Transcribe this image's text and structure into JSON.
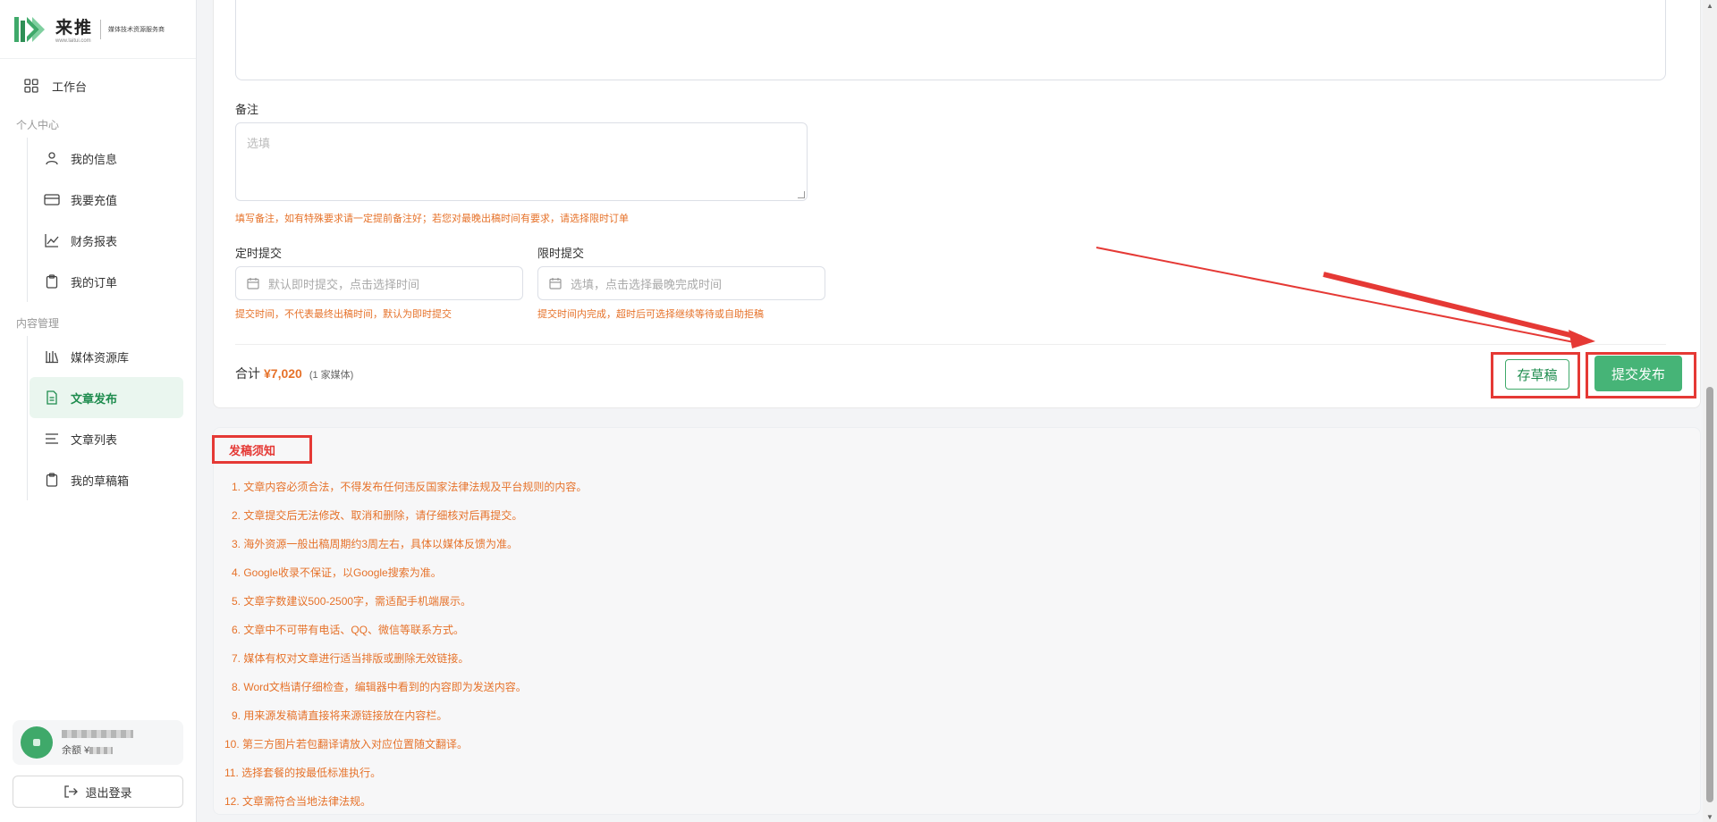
{
  "brand": {
    "title": "来推",
    "url": "www.laitui.com",
    "slogan": "媒体技术资源服务商",
    "green": "#3fa96a"
  },
  "sidebar": {
    "workbench": "工作台",
    "groups": [
      {
        "title": "个人中心",
        "items": [
          {
            "label": "我的信息",
            "icon": "user-icon"
          },
          {
            "label": "我要充值",
            "icon": "credit-card-icon"
          },
          {
            "label": "财务报表",
            "icon": "chart-line-icon"
          },
          {
            "label": "我的订单",
            "icon": "clipboard-icon"
          }
        ]
      },
      {
        "title": "内容管理",
        "items": [
          {
            "label": "媒体资源库",
            "icon": "library-icon"
          },
          {
            "label": "文章发布",
            "icon": "document-icon",
            "active": true
          },
          {
            "label": "文章列表",
            "icon": "list-icon"
          },
          {
            "label": "我的草稿箱",
            "icon": "clipboard-icon"
          }
        ]
      }
    ],
    "user": {
      "balance_label": "余额 ¥"
    },
    "logout": "退出登录"
  },
  "form": {
    "remark": {
      "label": "备注",
      "placeholder": "选填",
      "hint": "填写备注，如有特殊要求请一定提前备注好；若您对最晚出稿时间有要求，请选择限时订单"
    },
    "schedule": {
      "label": "定时提交",
      "placeholder": "默认即时提交，点击选择时间",
      "hint": "提交时间，不代表最终出稿时间，默认为即时提交"
    },
    "deadline": {
      "label": "限时提交",
      "placeholder": "选填，点击选择最晚完成时间",
      "hint": "提交时间内完成，超时后可选择继续等待或自助拒稿"
    },
    "total": {
      "label": "合计",
      "price": "¥7,020",
      "sub": "(1 家媒体)"
    },
    "buttons": {
      "draft": "存草稿",
      "submit": "提交发布"
    }
  },
  "notice": {
    "title": "发稿须知",
    "items": [
      "1. 文章内容必须合法，不得发布任何违反国家法律法规及平台规则的内容。",
      "2. 文章提交后无法修改、取消和删除，请仔细核对后再提交。",
      "3. 海外资源一般出稿周期约3周左右，具体以媒体反馈为准。",
      "4. Google收录不保证，以Google搜索为准。",
      "5. 文章字数建议500-2500字，需适配手机端展示。",
      "6. 文章中不可带有电话、QQ、微信等联系方式。",
      "7. 媒体有权对文章进行适当排版或删除无效链接。",
      "8. Word文档请仔细检查，编辑器中看到的内容即为发送内容。",
      "9. 用来源发稿请直接将来源链接放在内容栏。",
      "10. 第三方图片若包翻译请放入对应位置随文翻译。",
      "11. 选择套餐的按最低标准执行。",
      "12. 文章需符合当地法律法规。"
    ]
  },
  "colors": {
    "accent": "#3fa96a",
    "warning": "#e6722a",
    "annotation": "#e53935"
  }
}
